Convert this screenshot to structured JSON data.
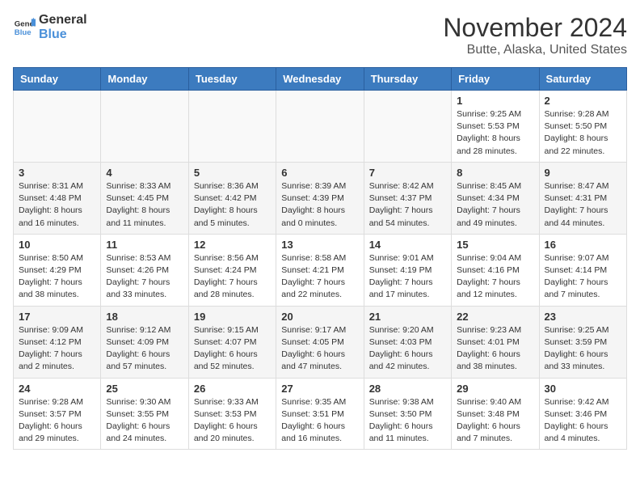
{
  "header": {
    "logo_general": "General",
    "logo_blue": "Blue",
    "title": "November 2024",
    "subtitle": "Butte, Alaska, United States"
  },
  "days_of_week": [
    "Sunday",
    "Monday",
    "Tuesday",
    "Wednesday",
    "Thursday",
    "Friday",
    "Saturday"
  ],
  "weeks": [
    [
      {
        "day": "",
        "info": ""
      },
      {
        "day": "",
        "info": ""
      },
      {
        "day": "",
        "info": ""
      },
      {
        "day": "",
        "info": ""
      },
      {
        "day": "",
        "info": ""
      },
      {
        "day": "1",
        "info": "Sunrise: 9:25 AM\nSunset: 5:53 PM\nDaylight: 8 hours and 28 minutes."
      },
      {
        "day": "2",
        "info": "Sunrise: 9:28 AM\nSunset: 5:50 PM\nDaylight: 8 hours and 22 minutes."
      }
    ],
    [
      {
        "day": "3",
        "info": "Sunrise: 8:31 AM\nSunset: 4:48 PM\nDaylight: 8 hours and 16 minutes."
      },
      {
        "day": "4",
        "info": "Sunrise: 8:33 AM\nSunset: 4:45 PM\nDaylight: 8 hours and 11 minutes."
      },
      {
        "day": "5",
        "info": "Sunrise: 8:36 AM\nSunset: 4:42 PM\nDaylight: 8 hours and 5 minutes."
      },
      {
        "day": "6",
        "info": "Sunrise: 8:39 AM\nSunset: 4:39 PM\nDaylight: 8 hours and 0 minutes."
      },
      {
        "day": "7",
        "info": "Sunrise: 8:42 AM\nSunset: 4:37 PM\nDaylight: 7 hours and 54 minutes."
      },
      {
        "day": "8",
        "info": "Sunrise: 8:45 AM\nSunset: 4:34 PM\nDaylight: 7 hours and 49 minutes."
      },
      {
        "day": "9",
        "info": "Sunrise: 8:47 AM\nSunset: 4:31 PM\nDaylight: 7 hours and 44 minutes."
      }
    ],
    [
      {
        "day": "10",
        "info": "Sunrise: 8:50 AM\nSunset: 4:29 PM\nDaylight: 7 hours and 38 minutes."
      },
      {
        "day": "11",
        "info": "Sunrise: 8:53 AM\nSunset: 4:26 PM\nDaylight: 7 hours and 33 minutes."
      },
      {
        "day": "12",
        "info": "Sunrise: 8:56 AM\nSunset: 4:24 PM\nDaylight: 7 hours and 28 minutes."
      },
      {
        "day": "13",
        "info": "Sunrise: 8:58 AM\nSunset: 4:21 PM\nDaylight: 7 hours and 22 minutes."
      },
      {
        "day": "14",
        "info": "Sunrise: 9:01 AM\nSunset: 4:19 PM\nDaylight: 7 hours and 17 minutes."
      },
      {
        "day": "15",
        "info": "Sunrise: 9:04 AM\nSunset: 4:16 PM\nDaylight: 7 hours and 12 minutes."
      },
      {
        "day": "16",
        "info": "Sunrise: 9:07 AM\nSunset: 4:14 PM\nDaylight: 7 hours and 7 minutes."
      }
    ],
    [
      {
        "day": "17",
        "info": "Sunrise: 9:09 AM\nSunset: 4:12 PM\nDaylight: 7 hours and 2 minutes."
      },
      {
        "day": "18",
        "info": "Sunrise: 9:12 AM\nSunset: 4:09 PM\nDaylight: 6 hours and 57 minutes."
      },
      {
        "day": "19",
        "info": "Sunrise: 9:15 AM\nSunset: 4:07 PM\nDaylight: 6 hours and 52 minutes."
      },
      {
        "day": "20",
        "info": "Sunrise: 9:17 AM\nSunset: 4:05 PM\nDaylight: 6 hours and 47 minutes."
      },
      {
        "day": "21",
        "info": "Sunrise: 9:20 AM\nSunset: 4:03 PM\nDaylight: 6 hours and 42 minutes."
      },
      {
        "day": "22",
        "info": "Sunrise: 9:23 AM\nSunset: 4:01 PM\nDaylight: 6 hours and 38 minutes."
      },
      {
        "day": "23",
        "info": "Sunrise: 9:25 AM\nSunset: 3:59 PM\nDaylight: 6 hours and 33 minutes."
      }
    ],
    [
      {
        "day": "24",
        "info": "Sunrise: 9:28 AM\nSunset: 3:57 PM\nDaylight: 6 hours and 29 minutes."
      },
      {
        "day": "25",
        "info": "Sunrise: 9:30 AM\nSunset: 3:55 PM\nDaylight: 6 hours and 24 minutes."
      },
      {
        "day": "26",
        "info": "Sunrise: 9:33 AM\nSunset: 3:53 PM\nDaylight: 6 hours and 20 minutes."
      },
      {
        "day": "27",
        "info": "Sunrise: 9:35 AM\nSunset: 3:51 PM\nDaylight: 6 hours and 16 minutes."
      },
      {
        "day": "28",
        "info": "Sunrise: 9:38 AM\nSunset: 3:50 PM\nDaylight: 6 hours and 11 minutes."
      },
      {
        "day": "29",
        "info": "Sunrise: 9:40 AM\nSunset: 3:48 PM\nDaylight: 6 hours and 7 minutes."
      },
      {
        "day": "30",
        "info": "Sunrise: 9:42 AM\nSunset: 3:46 PM\nDaylight: 6 hours and 4 minutes."
      }
    ]
  ]
}
